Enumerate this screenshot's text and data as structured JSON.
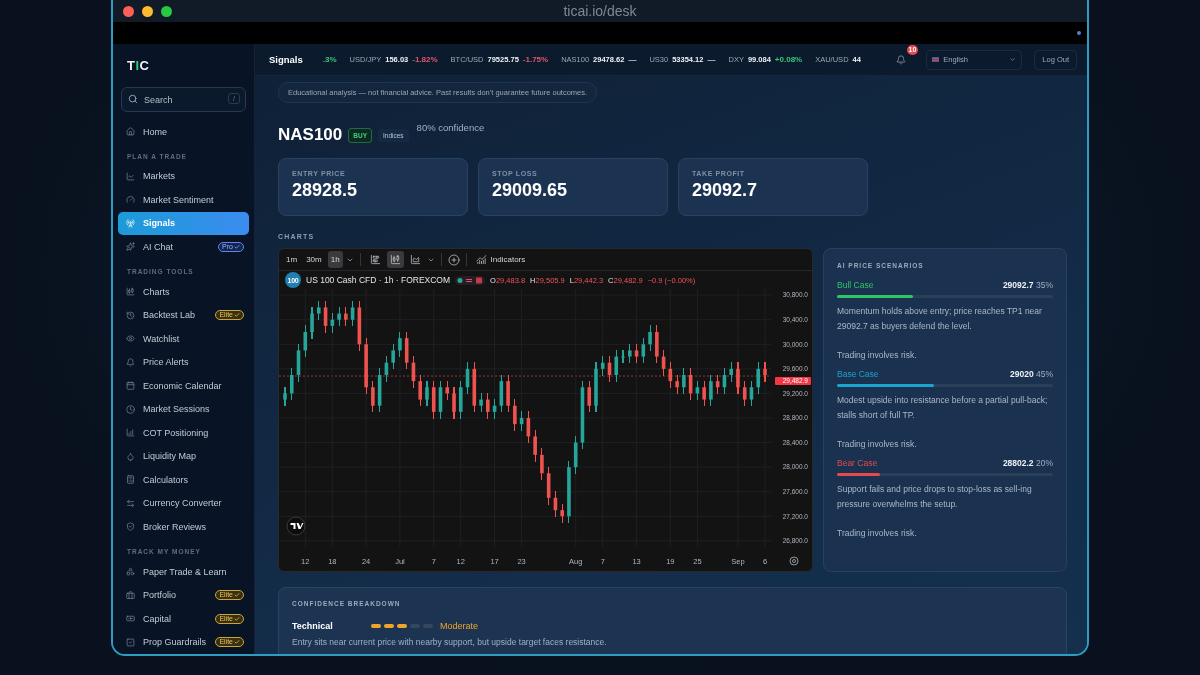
{
  "browser": {
    "url": "ticai.io/desk"
  },
  "sidebar": {
    "logo": [
      {
        "text": "T",
        "accent": false
      },
      {
        "text": "I",
        "accent": true
      },
      {
        "text": "C",
        "accent": false
      }
    ],
    "search": {
      "placeholder": "Search",
      "shortcut": "/"
    },
    "sections": [
      {
        "items": [
          {
            "label": "Home",
            "selected": false
          }
        ]
      },
      {
        "title": "PLAN A TRADE",
        "items": [
          {
            "label": "Markets",
            "selected": false
          },
          {
            "label": "Market Sentiment",
            "selected": false
          },
          {
            "label": "Signals",
            "selected": true
          },
          {
            "label": "AI Chat",
            "selected": false,
            "badge": {
              "text": "Pro",
              "kind": "pro"
            }
          }
        ]
      },
      {
        "title": "TRADING TOOLS",
        "items": [
          {
            "label": "Charts",
            "selected": false
          },
          {
            "label": "Backtest Lab",
            "selected": false,
            "badge": {
              "text": "Elite",
              "kind": "elite"
            }
          },
          {
            "label": "Watchlist",
            "selected": false
          },
          {
            "label": "Price Alerts",
            "selected": false
          },
          {
            "label": "Economic Calendar",
            "selected": false
          },
          {
            "label": "Market Sessions",
            "selected": false
          },
          {
            "label": "COT Positioning",
            "selected": false
          },
          {
            "label": "Liquidity Map",
            "selected": false
          },
          {
            "label": "Calculators",
            "selected": false
          },
          {
            "label": "Currency Converter",
            "selected": false
          },
          {
            "label": "Broker Reviews",
            "selected": false
          }
        ]
      },
      {
        "title": "TRACK MY MONEY",
        "items": [
          {
            "label": "Paper Trade & Learn",
            "selected": false
          },
          {
            "label": "Portfolio",
            "selected": false,
            "badge": {
              "text": "Elite",
              "kind": "elite"
            }
          },
          {
            "label": "Capital",
            "selected": false,
            "badge": {
              "text": "Elite",
              "kind": "elite"
            }
          },
          {
            "label": "Prop Guardrails",
            "selected": false,
            "badge": {
              "text": "Elite",
              "kind": "elite"
            }
          }
        ]
      }
    ]
  },
  "topbar": {
    "title": "Signals",
    "ticker": [
      {
        "change": ".3%",
        "color": "#3bc47a"
      },
      {
        "symbol": "USD/JPY",
        "price": "156.03",
        "change": "-1.82%",
        "color": "#e0566a"
      },
      {
        "symbol": "BTC/USD",
        "price": "79525.75",
        "change": "-1.75%",
        "color": "#e0566a"
      },
      {
        "symbol": "NAS100",
        "price": "29478.62",
        "change": "—"
      },
      {
        "symbol": "US30",
        "price": "53354.12",
        "change": "—"
      },
      {
        "symbol": "DXY",
        "price": "99.084",
        "change": "+0.08%",
        "color": "#3bc47a"
      },
      {
        "symbol": "XAU/USD",
        "price": "44"
      }
    ],
    "notifications": "10",
    "language": "English",
    "logout": "Log Out"
  },
  "disclaimer": "Educational analysis — not financial advice. Past results don't guarantee future outcomes.",
  "signal": {
    "symbol": "NAS100",
    "direction": "BUY",
    "category": "Indices",
    "confidence": "80% confidence"
  },
  "stats": [
    {
      "label": "ENTRY PRICE",
      "value": "28928.5"
    },
    {
      "label": "STOP LOSS",
      "value": "29009.65"
    },
    {
      "label": "TAKE PROFIT",
      "value": "29092.7"
    }
  ],
  "charts_heading": "CHARTS",
  "chart": {
    "intervals": [
      {
        "label": "1m",
        "selected": false
      },
      {
        "label": "30m",
        "selected": false
      },
      {
        "label": "1h",
        "selected": true
      }
    ],
    "styles": [
      {
        "kind": "bars",
        "selected": false
      },
      {
        "kind": "candles",
        "selected": true
      },
      {
        "kind": "area",
        "selected": false
      }
    ],
    "indicators": "Indicators",
    "instrument_logo": "100",
    "instrument": "US 100 Cash CFD · 1h · FOREXCOM",
    "ohlc": [
      {
        "label": "O",
        "value": "29,483.8"
      },
      {
        "label": "H",
        "value": "29,505.9"
      },
      {
        "label": "L",
        "value": "29,442.3"
      },
      {
        "label": "C",
        "value": "29,482.9"
      }
    ],
    "change": "−0.9 (−0.00%)",
    "chart_data": {
      "type": "candlestick",
      "grid": true,
      "ylim": [
        26700,
        30900
      ],
      "yticks": [
        {
          "value": 30800,
          "label": "30,800.0"
        },
        {
          "value": 30400,
          "label": "30,400.0"
        },
        {
          "value": 30000,
          "label": "30,000.0"
        },
        {
          "value": 29600,
          "label": "29,600.0"
        },
        {
          "value": 29200,
          "label": "29,200.0"
        },
        {
          "value": 28800,
          "label": "28,800.0"
        },
        {
          "value": 28400,
          "label": "28,400.0"
        },
        {
          "value": 28000,
          "label": "28,000.0"
        },
        {
          "value": 27600,
          "label": "27,600.0"
        },
        {
          "value": 27200,
          "label": "27,200.0"
        },
        {
          "value": 26800,
          "label": "26,800.0"
        }
      ],
      "ref_lines": [
        {
          "axis": "y",
          "value": 29482.9,
          "label": "29,482.9",
          "color": "#f0525c"
        }
      ],
      "categories": [
        null,
        null,
        null,
        "12",
        null,
        null,
        null,
        "18",
        null,
        null,
        null,
        null,
        "24",
        null,
        null,
        null,
        null,
        "Jul",
        null,
        null,
        null,
        null,
        "7",
        null,
        null,
        null,
        "12",
        null,
        null,
        null,
        null,
        "17",
        null,
        null,
        null,
        "23",
        null,
        null,
        null,
        null,
        null,
        null,
        null,
        "Aug",
        null,
        null,
        null,
        "7",
        null,
        null,
        null,
        null,
        "13",
        null,
        null,
        null,
        null,
        "19",
        null,
        null,
        null,
        "25",
        null,
        null,
        null,
        null,
        null,
        "Sep",
        null,
        null,
        null,
        "6"
      ],
      "ohlc": [
        [
          29100,
          29300,
          29000,
          29200
        ],
        [
          29200,
          29600,
          29100,
          29500
        ],
        [
          29500,
          30000,
          29400,
          29900
        ],
        [
          29900,
          30300,
          29800,
          30200
        ],
        [
          30200,
          30600,
          30100,
          30500
        ],
        [
          30500,
          30700,
          30400,
          30600
        ],
        [
          30600,
          30700,
          30200,
          30300
        ],
        [
          30300,
          30500,
          30200,
          30400
        ],
        [
          30400,
          30600,
          30300,
          30500
        ],
        [
          30500,
          30600,
          30300,
          30400
        ],
        [
          30400,
          30700,
          30300,
          30600
        ],
        [
          30600,
          30700,
          29900,
          30000
        ],
        [
          30000,
          30100,
          29200,
          29300
        ],
        [
          29300,
          29400,
          28900,
          29000
        ],
        [
          29000,
          29600,
          28900,
          29500
        ],
        [
          29500,
          29800,
          29400,
          29700
        ],
        [
          29700,
          30000,
          29600,
          29900
        ],
        [
          29900,
          30200,
          29800,
          30100
        ],
        [
          30100,
          30200,
          29600,
          29700
        ],
        [
          29700,
          29800,
          29300,
          29400
        ],
        [
          29400,
          29500,
          29000,
          29100
        ],
        [
          29100,
          29400,
          29000,
          29300
        ],
        [
          29300,
          29400,
          28800,
          28900
        ],
        [
          28900,
          29400,
          28800,
          29300
        ],
        [
          29300,
          29400,
          29100,
          29200
        ],
        [
          29200,
          29300,
          28800,
          28900
        ],
        [
          28900,
          29400,
          28800,
          29300
        ],
        [
          29300,
          29700,
          29200,
          29600
        ],
        [
          29600,
          29700,
          28900,
          29000
        ],
        [
          29000,
          29200,
          28900,
          29100
        ],
        [
          29100,
          29200,
          28800,
          28900
        ],
        [
          28900,
          29100,
          28800,
          29000
        ],
        [
          29000,
          29500,
          28900,
          29400
        ],
        [
          29400,
          29500,
          28900,
          29000
        ],
        [
          29000,
          29100,
          28600,
          28700
        ],
        [
          28700,
          28900,
          28600,
          28800
        ],
        [
          28800,
          28900,
          28400,
          28500
        ],
        [
          28500,
          28600,
          28100,
          28200
        ],
        [
          28200,
          28300,
          27800,
          27900
        ],
        [
          27900,
          28000,
          27400,
          27500
        ],
        [
          27500,
          27600,
          27200,
          27300
        ],
        [
          27300,
          27400,
          27100,
          27200
        ],
        [
          27200,
          28100,
          27100,
          28000
        ],
        [
          28000,
          28500,
          27900,
          28400
        ],
        [
          28400,
          29400,
          28300,
          29300
        ],
        [
          29300,
          29400,
          28900,
          29000
        ],
        [
          29000,
          29700,
          28900,
          29600
        ],
        [
          29600,
          29800,
          29500,
          29700
        ],
        [
          29700,
          29800,
          29400,
          29500
        ],
        [
          29500,
          29900,
          29400,
          29800
        ],
        [
          29800,
          29900,
          29700,
          29800
        ],
        [
          29800,
          30000,
          29700,
          29900
        ],
        [
          29900,
          30000,
          29700,
          29800
        ],
        [
          29800,
          30100,
          29700,
          30000
        ],
        [
          30000,
          30300,
          29900,
          30200
        ],
        [
          30200,
          30300,
          29700,
          29800
        ],
        [
          29800,
          29900,
          29500,
          29600
        ],
        [
          29600,
          29700,
          29300,
          29400
        ],
        [
          29400,
          29500,
          29200,
          29300
        ],
        [
          29300,
          29600,
          29200,
          29500
        ],
        [
          29500,
          29600,
          29100,
          29200
        ],
        [
          29200,
          29400,
          29100,
          29300
        ],
        [
          29300,
          29400,
          29000,
          29100
        ],
        [
          29100,
          29500,
          29000,
          29400
        ],
        [
          29400,
          29500,
          29200,
          29300
        ],
        [
          29300,
          29600,
          29200,
          29500
        ],
        [
          29500,
          29700,
          29400,
          29600
        ],
        [
          29600,
          29700,
          29200,
          29300
        ],
        [
          29300,
          29400,
          29000,
          29100
        ],
        [
          29100,
          29400,
          29000,
          29300
        ],
        [
          29300,
          29700,
          29200,
          29600
        ],
        [
          29600,
          29700,
          29400,
          29500
        ]
      ]
    }
  },
  "scenarios": {
    "title": "AI PRICE SCENARIOS",
    "items": [
      {
        "kind": "bull",
        "name": "Bull Case",
        "target": "29092.7",
        "probability": "35%",
        "level": 0.35,
        "text": "Momentum holds above entry; price reaches TP1 near 29092.7 as buyers defend the level.",
        "note": "Trading involves risk."
      },
      {
        "kind": "base",
        "name": "Base Case",
        "target": "29020",
        "probability": "45%",
        "level": 0.45,
        "text": "Modest upside into resistance before a partial pull-back; stalls short of full TP.",
        "note": "Trading involves risk."
      },
      {
        "kind": "bear",
        "name": "Bear Case",
        "target": "28802.2",
        "probability": "20%",
        "level": 0.2,
        "text": "Support fails and price drops to stop-loss as sell-ing pressure overwhelms the setup.",
        "note": "Trading involves risk."
      }
    ]
  },
  "confidence": {
    "title": "CONFIDENCE BREAKDOWN",
    "rows": [
      {
        "label": "Technical",
        "level": 0.6,
        "rating": "Moderate",
        "text": "Entry sits near current price with nearby support, but upside target faces resistance."
      }
    ]
  }
}
